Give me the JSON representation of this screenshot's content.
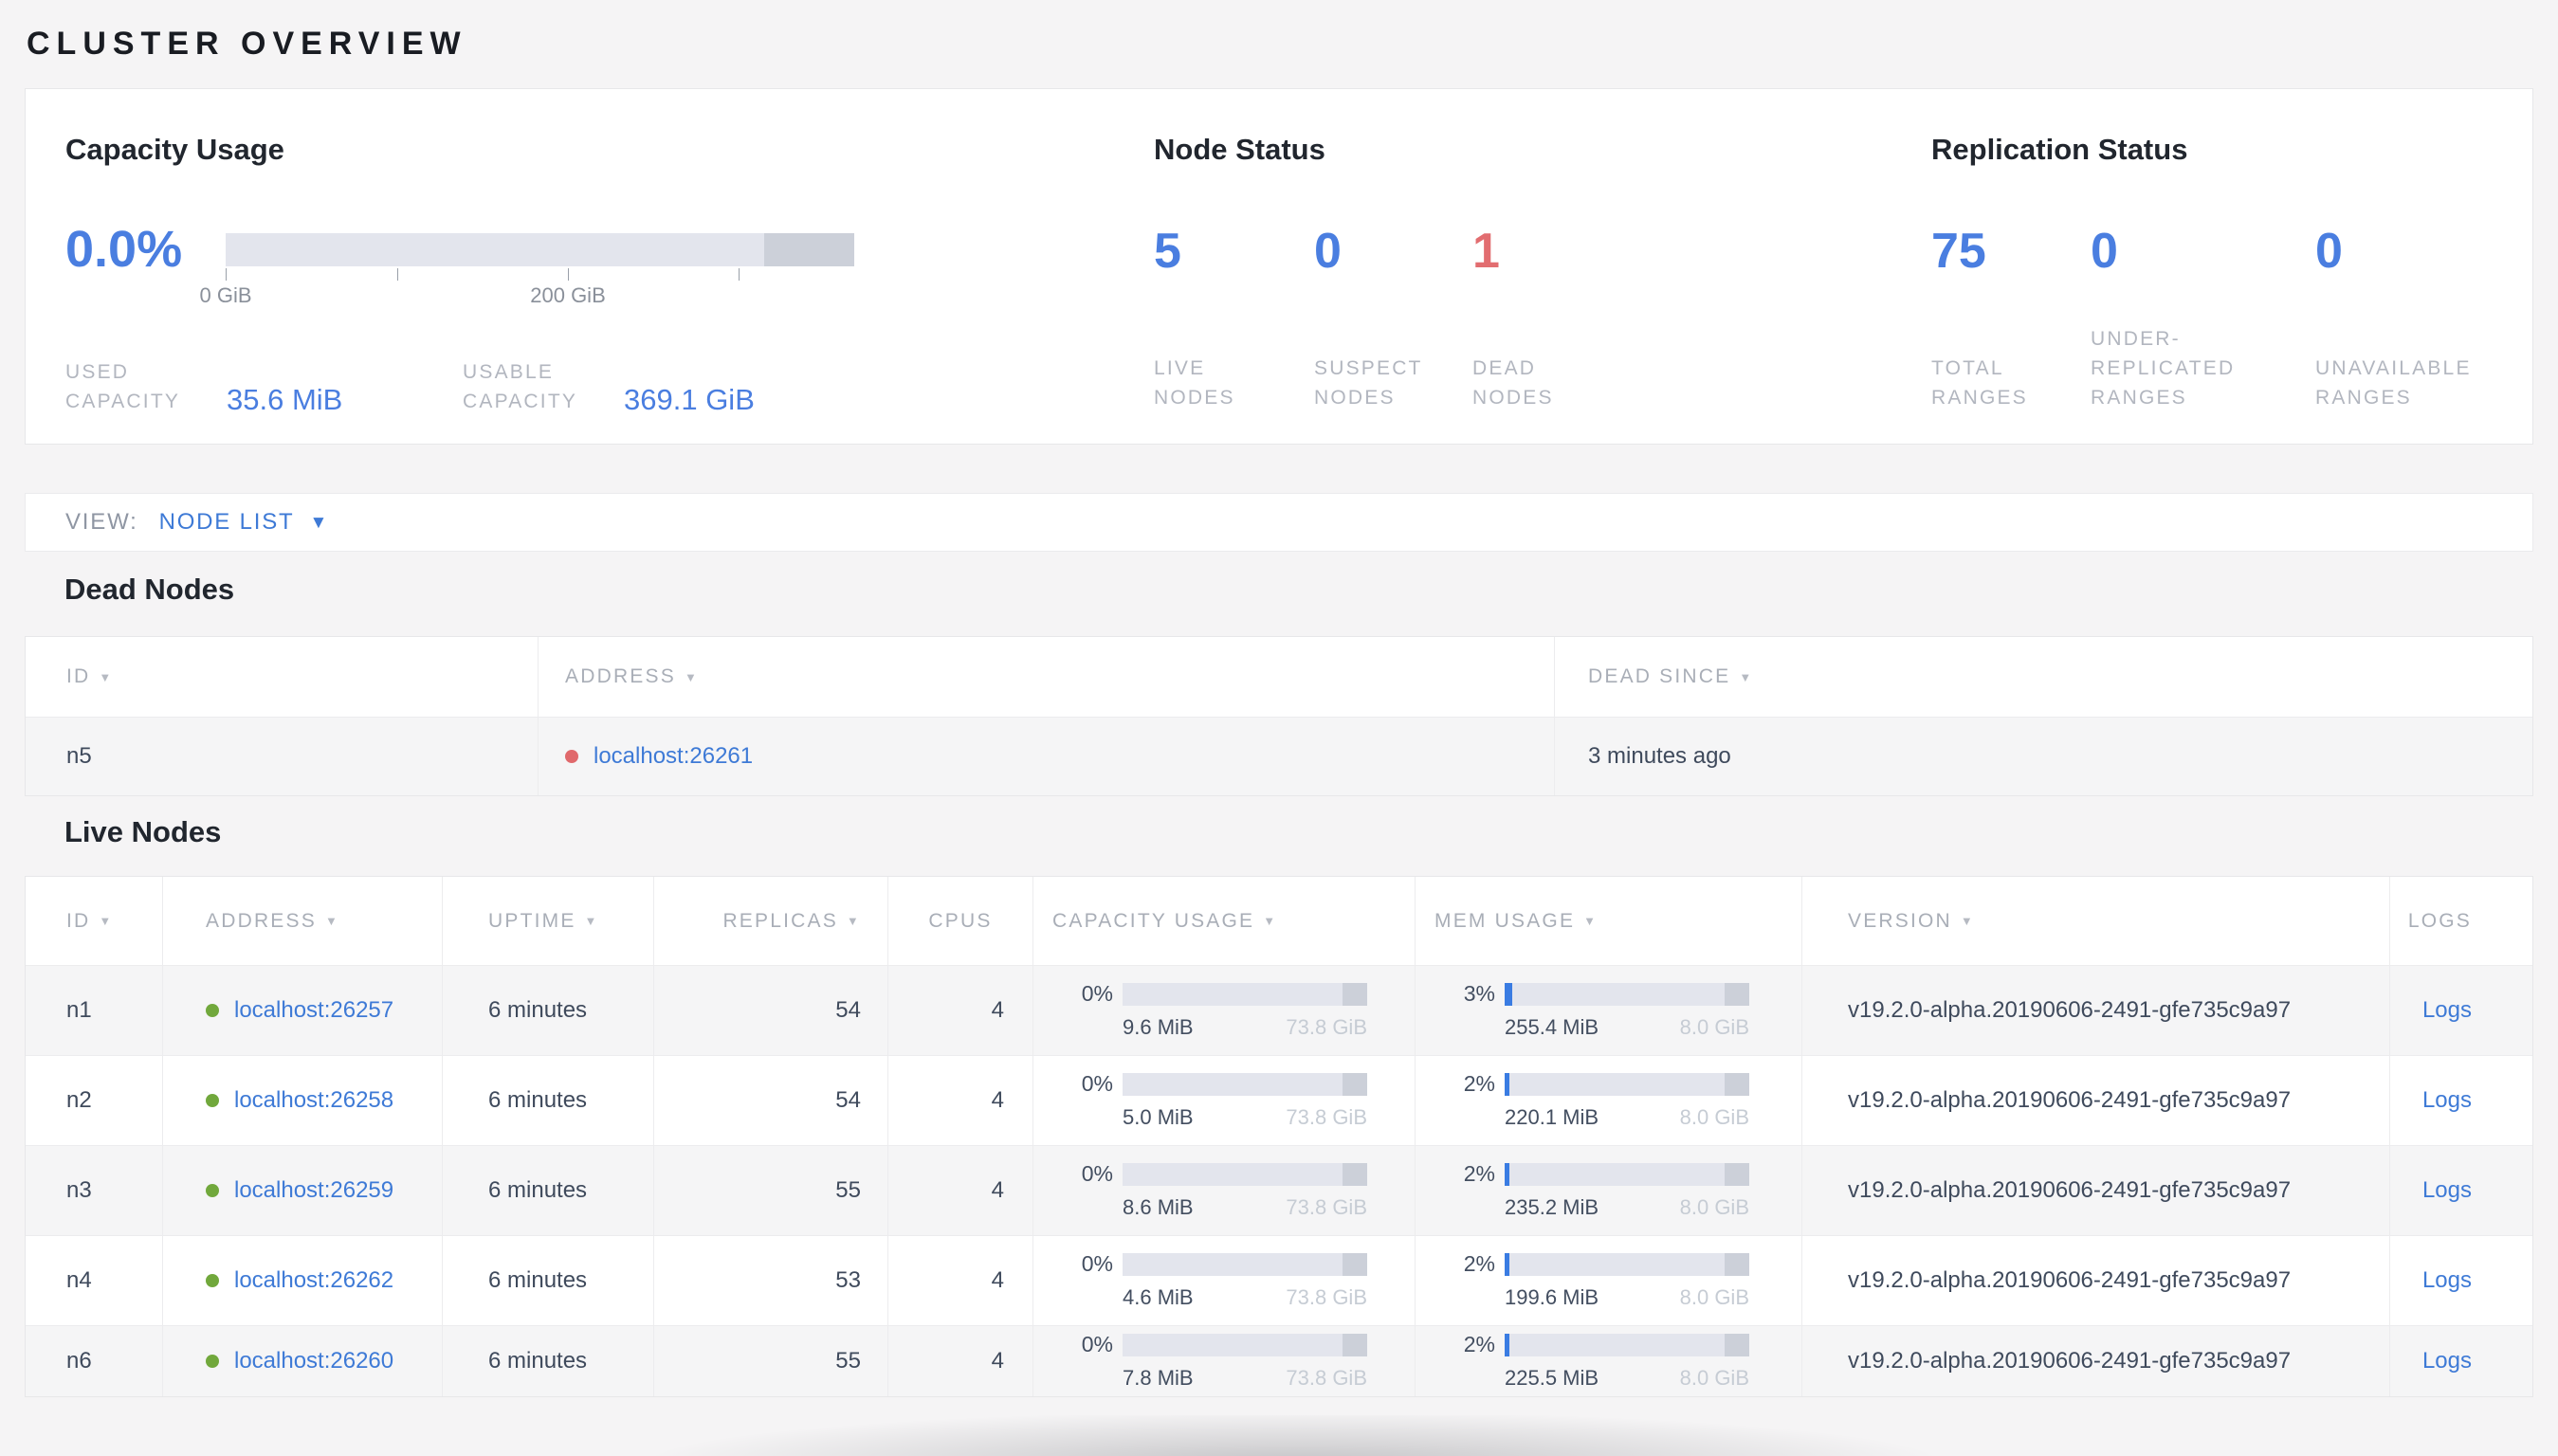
{
  "page": {
    "title": "CLUSTER OVERVIEW"
  },
  "summary": {
    "capacity": {
      "title": "Capacity Usage",
      "percent": "0.0%",
      "tick_labels": [
        "0 GiB",
        "200 GiB"
      ],
      "stats": [
        {
          "label": "USED CAPACITY",
          "value": "35.6 MiB"
        },
        {
          "label": "USABLE CAPACITY",
          "value": "369.1 GiB"
        }
      ]
    },
    "node_status": {
      "title": "Node Status",
      "stats": [
        {
          "value": "5",
          "label": "LIVE NODES",
          "color": "#4a7ee0"
        },
        {
          "value": "0",
          "label": "SUSPECT NODES",
          "color": "#4a7ee0"
        },
        {
          "value": "1",
          "label": "DEAD NODES",
          "color": "#e26d70"
        }
      ]
    },
    "replication": {
      "title": "Replication Status",
      "stats": [
        {
          "value": "75",
          "label": "TOTAL RANGES",
          "color": "#4a7ee0"
        },
        {
          "value": "0",
          "label": "UNDER-REPLICATED RANGES",
          "color": "#4a7ee0"
        },
        {
          "value": "0",
          "label": "UNAVAILABLE RANGES",
          "color": "#4a7ee0"
        }
      ]
    }
  },
  "view_bar": {
    "label": "VIEW:",
    "selected": "NODE LIST",
    "caret_icon": "▼"
  },
  "dead_nodes": {
    "title": "Dead Nodes",
    "columns": [
      {
        "label": "ID",
        "sortable": true
      },
      {
        "label": "ADDRESS",
        "sortable": true
      },
      {
        "label": "DEAD SINCE",
        "sortable": true
      }
    ],
    "rows": [
      {
        "id": "n5",
        "address": "localhost:26261",
        "dead_since": "3 minutes ago"
      }
    ]
  },
  "live_nodes": {
    "title": "Live Nodes",
    "columns": [
      {
        "label": "ID",
        "sortable": true
      },
      {
        "label": "ADDRESS",
        "sortable": true
      },
      {
        "label": "UPTIME",
        "sortable": true
      },
      {
        "label": "REPLICAS",
        "sortable": true
      },
      {
        "label": "CPUS",
        "sortable": false
      },
      {
        "label": "CAPACITY USAGE",
        "sortable": true
      },
      {
        "label": "MEM USAGE",
        "sortable": true
      },
      {
        "label": "VERSION",
        "sortable": true
      },
      {
        "label": "LOGS",
        "sortable": false
      }
    ],
    "rows": [
      {
        "id": "n1",
        "address": "localhost:26257",
        "uptime": "6 minutes",
        "replicas": "54",
        "cpus": "4",
        "capacity": {
          "percent": "0%",
          "fill_pct": 0,
          "used": "9.6 MiB",
          "total": "73.8 GiB"
        },
        "mem": {
          "percent": "3%",
          "fill_pct": 3,
          "used": "255.4 MiB",
          "total": "8.0 GiB"
        },
        "version": "v19.2.0-alpha.20190606-2491-gfe735c9a97",
        "logs": "Logs"
      },
      {
        "id": "n2",
        "address": "localhost:26258",
        "uptime": "6 minutes",
        "replicas": "54",
        "cpus": "4",
        "capacity": {
          "percent": "0%",
          "fill_pct": 0,
          "used": "5.0 MiB",
          "total": "73.8 GiB"
        },
        "mem": {
          "percent": "2%",
          "fill_pct": 2,
          "used": "220.1 MiB",
          "total": "8.0 GiB"
        },
        "version": "v19.2.0-alpha.20190606-2491-gfe735c9a97",
        "logs": "Logs"
      },
      {
        "id": "n3",
        "address": "localhost:26259",
        "uptime": "6 minutes",
        "replicas": "55",
        "cpus": "4",
        "capacity": {
          "percent": "0%",
          "fill_pct": 0,
          "used": "8.6 MiB",
          "total": "73.8 GiB"
        },
        "mem": {
          "percent": "2%",
          "fill_pct": 2,
          "used": "235.2 MiB",
          "total": "8.0 GiB"
        },
        "version": "v19.2.0-alpha.20190606-2491-gfe735c9a97",
        "logs": "Logs"
      },
      {
        "id": "n4",
        "address": "localhost:26262",
        "uptime": "6 minutes",
        "replicas": "53",
        "cpus": "4",
        "capacity": {
          "percent": "0%",
          "fill_pct": 0,
          "used": "4.6 MiB",
          "total": "73.8 GiB"
        },
        "mem": {
          "percent": "2%",
          "fill_pct": 2,
          "used": "199.6 MiB",
          "total": "8.0 GiB"
        },
        "version": "v19.2.0-alpha.20190606-2491-gfe735c9a97",
        "logs": "Logs"
      },
      {
        "id": "n6",
        "address": "localhost:26260",
        "uptime": "6 minutes",
        "replicas": "55",
        "cpus": "4",
        "capacity": {
          "percent": "0%",
          "fill_pct": 0,
          "used": "7.8 MiB",
          "total": "73.8 GiB"
        },
        "mem": {
          "percent": "2%",
          "fill_pct": 2,
          "used": "225.5 MiB",
          "total": "8.0 GiB"
        },
        "version": "v19.2.0-alpha.20190606-2491-gfe735c9a97",
        "logs": "Logs"
      }
    ]
  },
  "colors": {
    "accent_blue": "#3e7ad6",
    "stat_blue": "#4a7ee0",
    "danger_red": "#e26d70",
    "live_green": "#71a83c",
    "dead_red": "#e0696c",
    "bar_track": "#e3e5ed",
    "bar_reserved": "#ccd0d9",
    "bar_fill": "#3a7ce2"
  }
}
